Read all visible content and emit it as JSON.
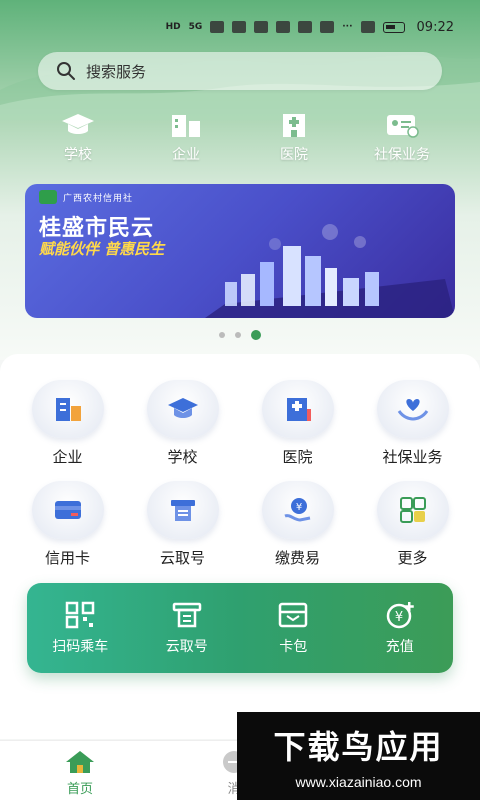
{
  "status_bar": {
    "time": "09:22",
    "network": "HD",
    "signal": "5G"
  },
  "search": {
    "placeholder": "搜索服务"
  },
  "top_categories": [
    {
      "label": "学校",
      "icon": "graduation-cap-icon"
    },
    {
      "label": "企业",
      "icon": "building-icon"
    },
    {
      "label": "医院",
      "icon": "hospital-icon"
    },
    {
      "label": "社保业务",
      "icon": "id-card-icon"
    }
  ],
  "banner": {
    "logo_text": "广西农村信用社",
    "title": "桂盛市民云",
    "subtitle": "赋能伙伴 普惠民生"
  },
  "carousel": {
    "total": 3,
    "active_index": 2
  },
  "services": [
    {
      "label": "企业",
      "icon": "building-icon"
    },
    {
      "label": "学校",
      "icon": "graduation-cap-icon"
    },
    {
      "label": "医院",
      "icon": "hospital-icon"
    },
    {
      "label": "社保业务",
      "icon": "heart-hands-icon"
    },
    {
      "label": "信用卡",
      "icon": "credit-card-icon"
    },
    {
      "label": "云取号",
      "icon": "ticket-machine-icon"
    },
    {
      "label": "缴费易",
      "icon": "yuan-hand-icon"
    },
    {
      "label": "更多",
      "icon": "grid-more-icon"
    }
  ],
  "quick_actions": [
    {
      "label": "扫码乘车",
      "icon": "qr-scan-icon"
    },
    {
      "label": "云取号",
      "icon": "ticket-machine-icon"
    },
    {
      "label": "卡包",
      "icon": "wallet-icon"
    },
    {
      "label": "充值",
      "icon": "yuan-plus-icon"
    }
  ],
  "tabbar": {
    "home_label": "首页",
    "msg_label": "消"
  },
  "watermark": {
    "title": "下载鸟应用",
    "url": "www.xiazainiao.com"
  },
  "colors": {
    "primary_green": "#3a9c57",
    "banner_blue": "#4a4fc9",
    "accent_yellow": "#ffd94a"
  }
}
